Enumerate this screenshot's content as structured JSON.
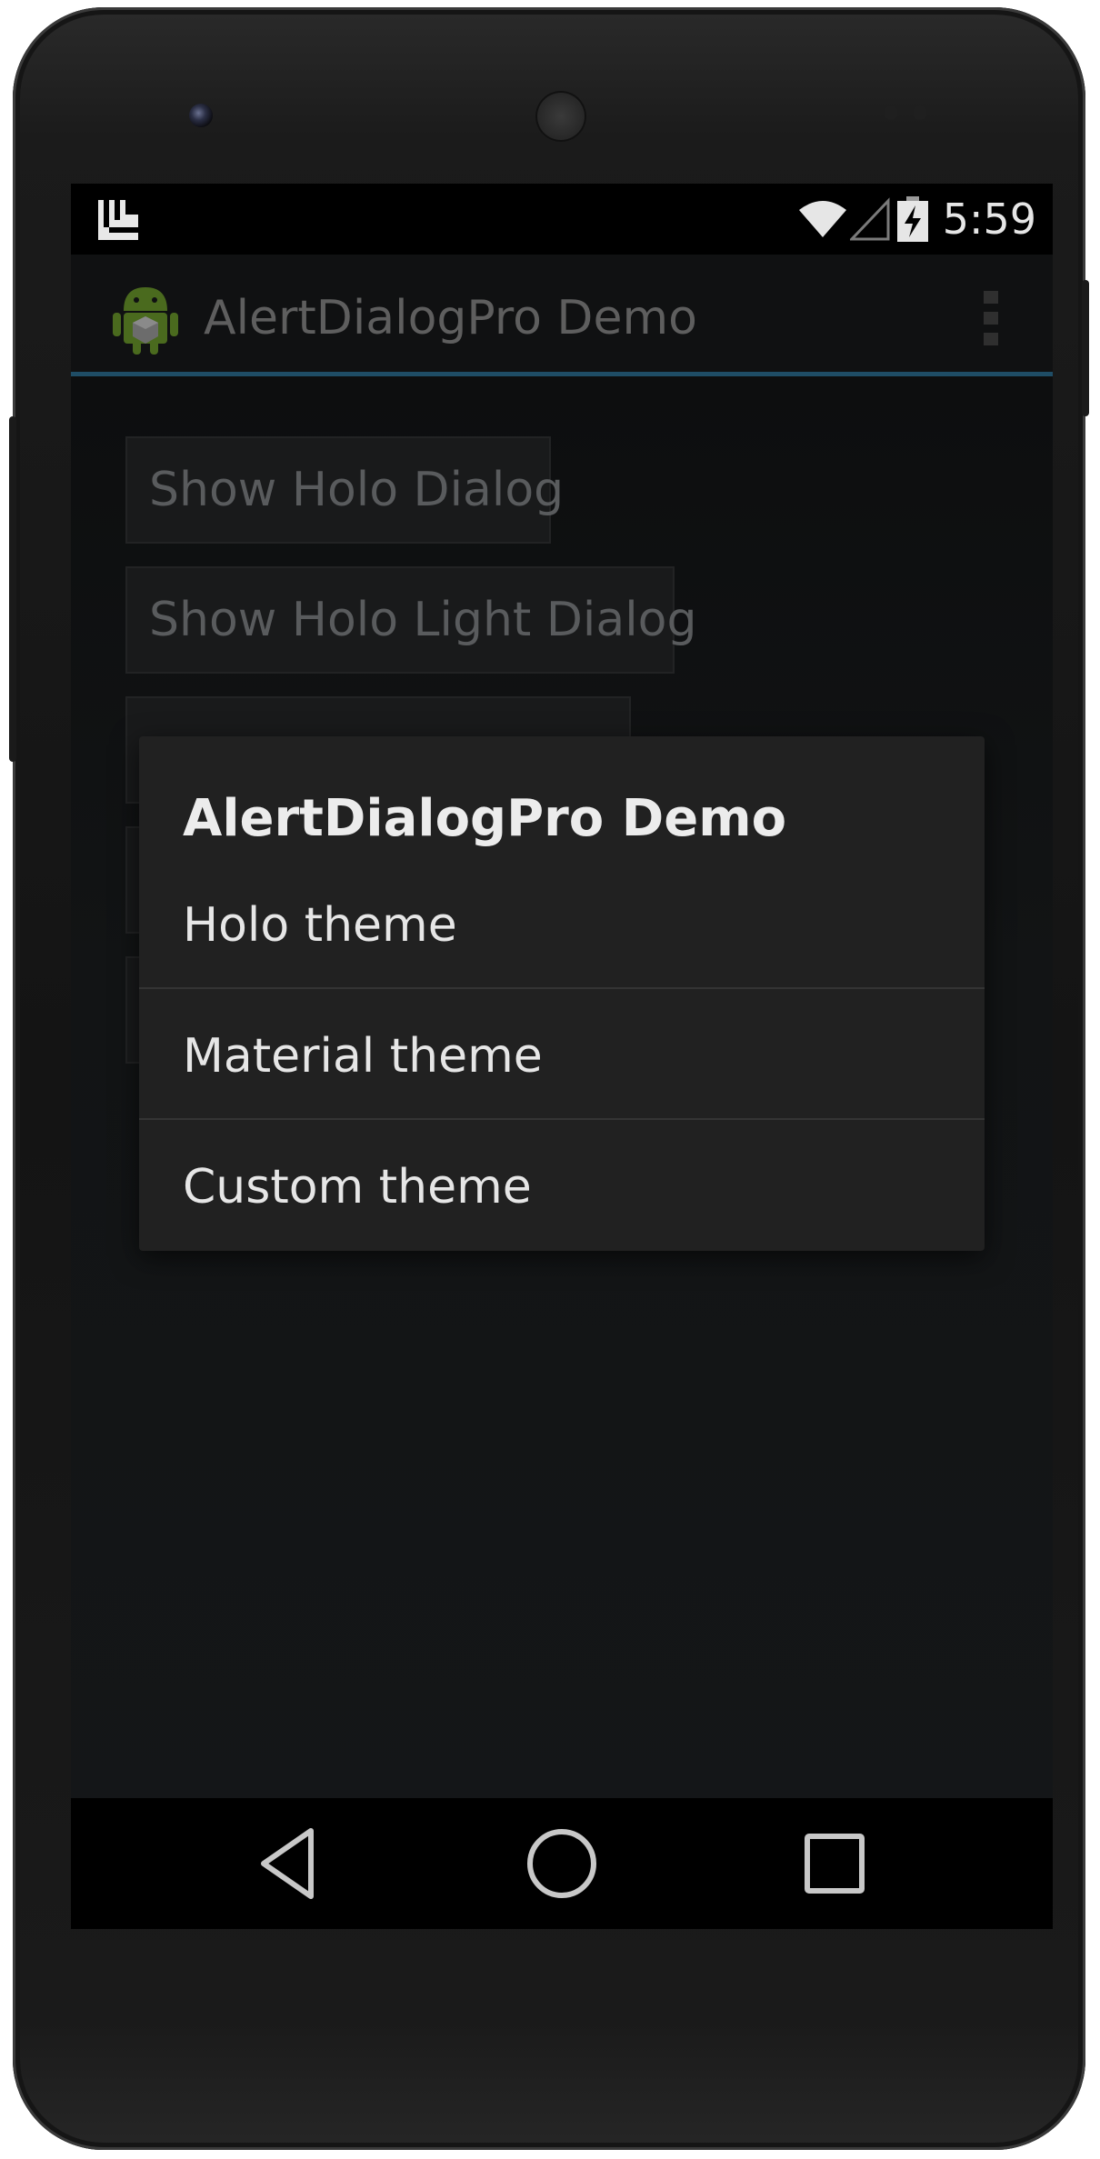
{
  "status_bar": {
    "time": "5:59",
    "left_icon": "launcher-notification-icon",
    "icons": [
      "wifi-icon",
      "signal-icon",
      "battery-charging-icon"
    ]
  },
  "action_bar": {
    "title": "AlertDialogPro Demo",
    "app_icon": "android-icon",
    "menu_icon": "overflow-menu-icon"
  },
  "buttons": [
    {
      "label": "Show Holo Dialog"
    },
    {
      "label": "Show Holo Light Dialog"
    },
    {
      "label": ""
    },
    {
      "label": ""
    },
    {
      "label": ""
    }
  ],
  "dialog": {
    "title": "AlertDialogPro Demo",
    "items": [
      {
        "label": "Holo theme"
      },
      {
        "label": "Material theme"
      },
      {
        "label": "Custom theme"
      }
    ]
  },
  "nav_bar": {
    "icons": [
      "back-icon",
      "home-icon",
      "recents-icon"
    ]
  },
  "colors": {
    "accent_divider": "#1f4d66",
    "dialog_background": "#212121",
    "screen_background": "#121415"
  }
}
